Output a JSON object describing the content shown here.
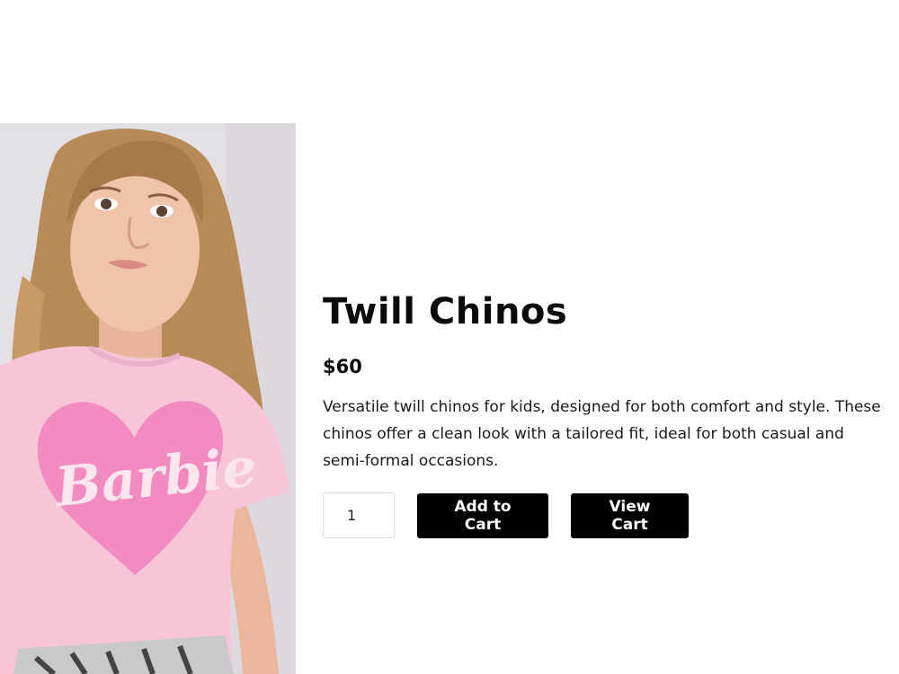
{
  "product": {
    "image": {
      "alt": "Girl wearing pink Barbie heart t-shirt",
      "shirt_graphic_text": "Barbie"
    },
    "title": "Twill Chinos",
    "price": "$60",
    "description_lines": [
      "Versatile twill chinos for kids, designed for both comfort and style. These",
      "chinos offer a clean look with a tailored fit, ideal for both casual and",
      "semi-formal occasions."
    ]
  },
  "cart": {
    "quantity": "1",
    "add_to_cart_label": "Add to Cart",
    "view_cart_label": "View Cart"
  },
  "colors": {
    "button_bg": "#000000",
    "button_text": "#ffffff",
    "shirt_pink": "#f6c6d8",
    "heart_pink": "#f28cc0"
  }
}
